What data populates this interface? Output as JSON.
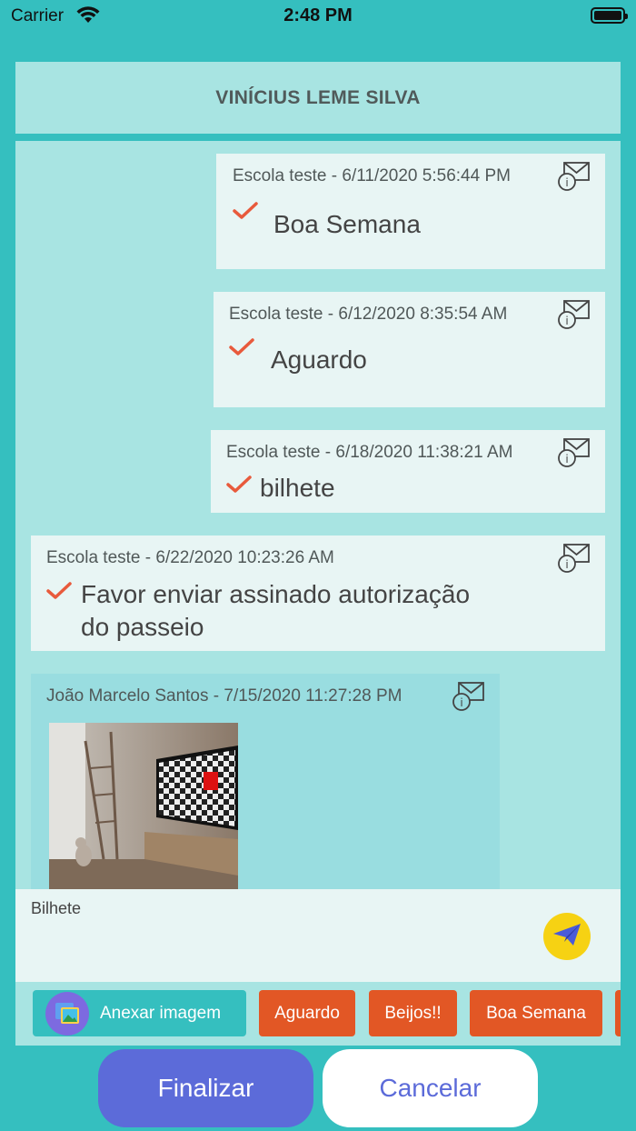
{
  "status_bar": {
    "carrier": "Carrier",
    "time": "2:48 PM",
    "icons": [
      "wifi-icon",
      "battery-icon"
    ]
  },
  "header": {
    "title": "VINÍCIUS LEME SILVA"
  },
  "messages": [
    {
      "meta": "Escola teste - 6/11/2020 5:56:44 PM",
      "text": "Boa Semana",
      "status": "read"
    },
    {
      "meta": "Escola teste - 6/12/2020 8:35:54 AM",
      "text": "Aguardo",
      "status": "read"
    },
    {
      "meta": "Escola teste - 6/18/2020 11:38:21 AM",
      "text": "bilhete",
      "status": "read"
    },
    {
      "meta": "Escola teste - 6/22/2020 10:23:26 AM",
      "text_line1": "Favor enviar assinado autorização",
      "text_line2": "do passeio",
      "status": "read"
    },
    {
      "meta": "João Marcelo Santos - 7/15/2020 11:27:28 PM",
      "attachment": "image"
    }
  ],
  "input": {
    "label": "Bilhete",
    "placeholder": ""
  },
  "quick_replies": {
    "attach_label": "Anexar imagem",
    "items": [
      "Aguardo",
      "Beijos!!",
      "Boa Semana"
    ]
  },
  "actions": {
    "finalize": "Finalizar",
    "cancel": "Cancelar"
  },
  "colors": {
    "background": "#35bfbf",
    "panel": "#a8e4e2",
    "bubble": "#e8f5f4",
    "accent": "#5c6bd9",
    "orange": "#e25725",
    "check": "#e85a3c",
    "send": "#f6d213"
  }
}
